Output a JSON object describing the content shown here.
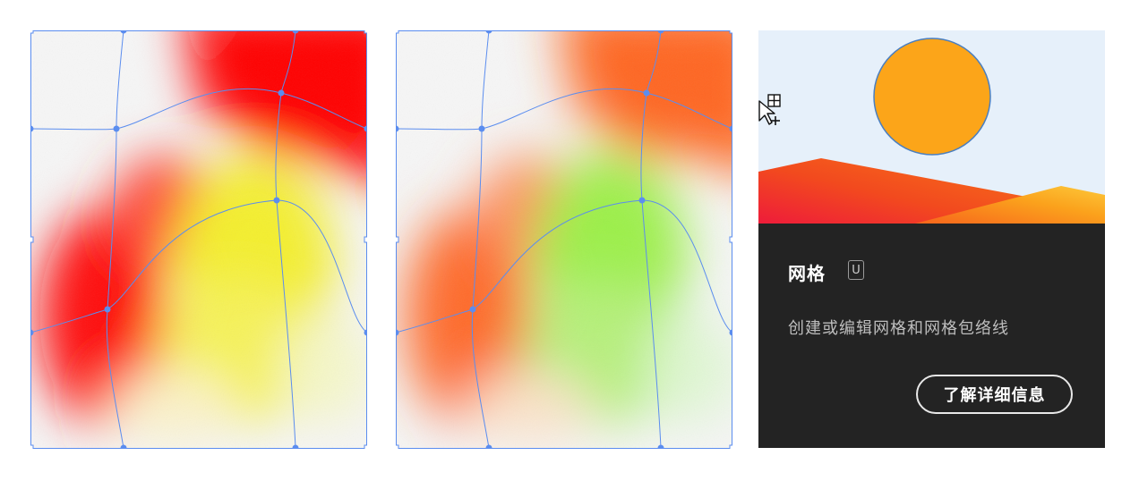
{
  "tooltip": {
    "tool_name": "网格",
    "shortcut": "U",
    "description": "创建或编辑网格和网格包络线",
    "learn_more_label": "了解详细信息"
  },
  "icons": {
    "cursor": "mesh-tool-cursor-icon"
  },
  "colors": {
    "panel_bg": "#232323",
    "mesh_line": "#5b8def",
    "preview_sky": "#e6f0fa",
    "preview_sun": "#fca519",
    "left_mesh_palette": [
      "#ff0000",
      "#f7f52a",
      "#f5f5f5"
    ],
    "right_mesh_palette": [
      "#ff6a1a",
      "#9ef04a",
      "#f5f5f5"
    ]
  }
}
